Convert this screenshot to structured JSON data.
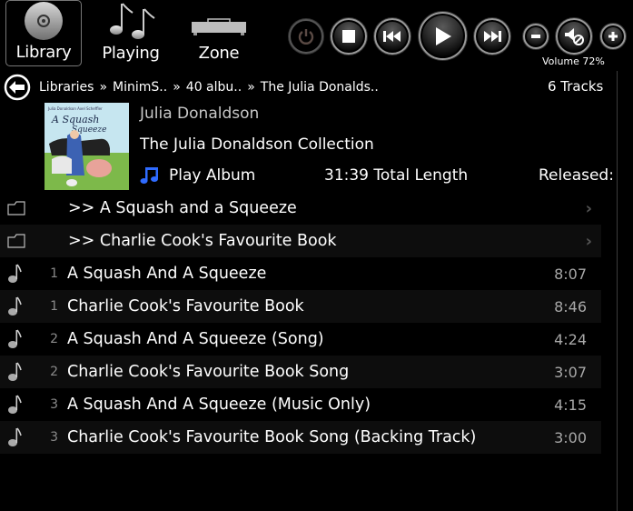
{
  "nav": {
    "items": [
      {
        "label": "Library",
        "icon": "cd-disc-icon",
        "active": true
      },
      {
        "label": "Playing",
        "icon": "music-notes-icon",
        "active": false
      },
      {
        "label": "Zone",
        "icon": "hifi-device-icon",
        "active": false
      }
    ]
  },
  "transport": {
    "power": "power-icon",
    "stop": "stop-icon",
    "previous": "skip-previous-icon",
    "play": "play-icon",
    "next": "skip-next-icon"
  },
  "volume": {
    "down": "volume-down-icon",
    "mute": "mute-icon",
    "up": "volume-up-icon",
    "label": "Volume 72%",
    "level_percent": 72
  },
  "breadcrumb": {
    "back_icon": "back-arrow-icon",
    "items": [
      "Libraries",
      "MinimS..",
      "40 albu..",
      "The Julia Donalds.."
    ],
    "separator": "»",
    "track_count": "6 Tracks"
  },
  "album": {
    "artist": "Julia Donaldson",
    "title": "The Julia Donaldson Collection",
    "play_label": "Play Album",
    "play_icon": "music-note-icon",
    "total_length": "31:39 Total Length",
    "released": "Released:",
    "art_colors": {
      "sky": "#bfe3ef",
      "grass": "#7db94a",
      "dress": "#3c62b3",
      "pig": "#e8a39a"
    }
  },
  "folders": [
    {
      "label": ">> A Squash and a Squeeze"
    },
    {
      "label": ">> Charlie Cook's Favourite Book"
    }
  ],
  "tracks": [
    {
      "num": "1",
      "title": "A Squash And A Squeeze",
      "duration": "8:07"
    },
    {
      "num": "1",
      "title": "Charlie Cook's Favourite Book",
      "duration": "8:46"
    },
    {
      "num": "2",
      "title": "A Squash And A Squeeze (Song)",
      "duration": "4:24"
    },
    {
      "num": "2",
      "title": "Charlie Cook's Favourite Book Song",
      "duration": "3:07"
    },
    {
      "num": "3",
      "title": "A Squash And A Squeeze (Music Only)",
      "duration": "4:15"
    },
    {
      "num": "3",
      "title": "Charlie Cook's Favourite Book Song (Backing Track)",
      "duration": "3:00"
    }
  ],
  "colors": {
    "accent_blue": "#2f6bff",
    "row_alt": "#0d0d0d",
    "duration": "#a8a8a8"
  }
}
